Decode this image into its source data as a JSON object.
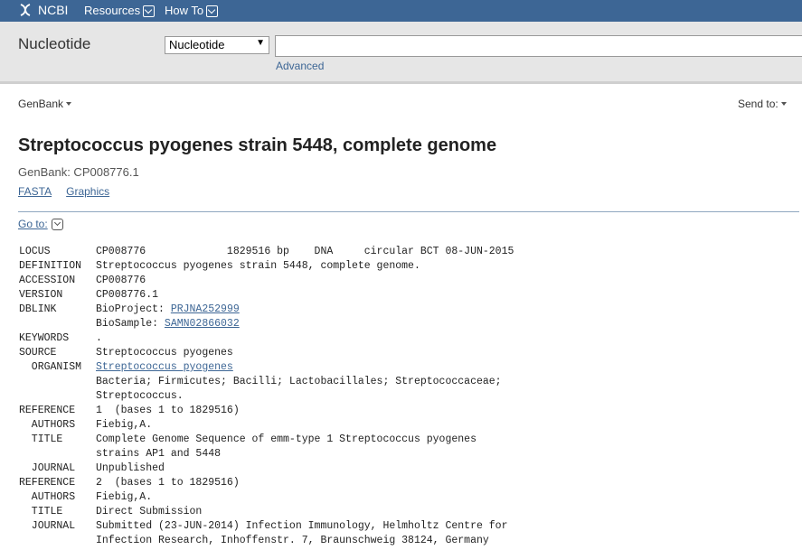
{
  "header": {
    "logo": "NCBI",
    "resources": "Resources",
    "howto": "How To"
  },
  "search": {
    "db_title": "Nucleotide",
    "db_selected": "Nucleotide",
    "query": "",
    "advanced": "Advanced"
  },
  "toolbar": {
    "format": "GenBank",
    "send_to": "Send to:"
  },
  "record": {
    "title": "Streptococcus pyogenes strain 5448, complete genome",
    "accession_line": "GenBank: CP008776.1",
    "link_fasta": "FASTA",
    "link_graphics": "Graphics",
    "goto": "Go to:"
  },
  "flatfile": [
    {
      "key": "LOCUS",
      "value": "CP008776             1829516 bp    DNA     circular BCT 08-JUN-2015"
    },
    {
      "key": "DEFINITION",
      "value": "Streptococcus pyogenes strain 5448, complete genome."
    },
    {
      "key": "ACCESSION",
      "value": "CP008776"
    },
    {
      "key": "VERSION",
      "value": "CP008776.1"
    },
    {
      "key": "DBLINK",
      "value": "BioProject: ",
      "link": "PRJNA252999"
    },
    {
      "key": "",
      "value": "BioSample: ",
      "link": "SAMN02866032"
    },
    {
      "key": "KEYWORDS",
      "value": "."
    },
    {
      "key": "SOURCE",
      "value": "Streptococcus pyogenes"
    },
    {
      "key": "  ORGANISM",
      "value": "",
      "link": "Streptococcus pyogenes"
    },
    {
      "key": "",
      "value": "Bacteria; Firmicutes; Bacilli; Lactobacillales; Streptococcaceae;"
    },
    {
      "key": "",
      "value": "Streptococcus."
    },
    {
      "key": "REFERENCE",
      "value": "1  (bases 1 to 1829516)"
    },
    {
      "key": "  AUTHORS",
      "value": "Fiebig,A."
    },
    {
      "key": "  TITLE",
      "value": "Complete Genome Sequence of emm-type 1 Streptococcus pyogenes"
    },
    {
      "key": "",
      "value": "strains AP1 and 5448"
    },
    {
      "key": "  JOURNAL",
      "value": "Unpublished"
    },
    {
      "key": "REFERENCE",
      "value": "2  (bases 1 to 1829516)"
    },
    {
      "key": "  AUTHORS",
      "value": "Fiebig,A."
    },
    {
      "key": "  TITLE",
      "value": "Direct Submission"
    },
    {
      "key": "  JOURNAL",
      "value": "Submitted (23-JUN-2014) Infection Immunology, Helmholtz Centre for"
    },
    {
      "key": "",
      "value": "Infection Research, Inhoffenstr. 7, Braunschweig 38124, Germany"
    }
  ]
}
